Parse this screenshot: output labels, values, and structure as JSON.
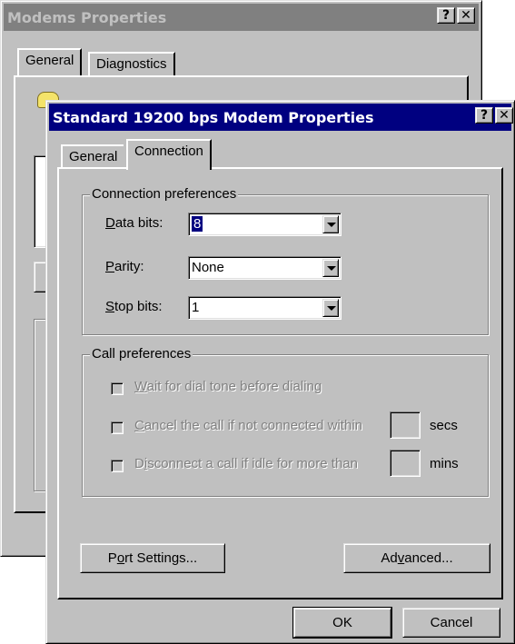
{
  "back_window": {
    "title": "Modems Properties",
    "help_button": "?",
    "close_button": "✕",
    "tabs": [
      "General",
      "Diagnostics"
    ]
  },
  "front_window": {
    "title": "Standard 19200 bps Modem Properties",
    "help_button": "?",
    "close_button": "✕",
    "tabs": [
      "General",
      "Connection"
    ],
    "active_tab": "Connection",
    "connection_preferences": {
      "legend": "Connection preferences",
      "data_bits": {
        "label_mnemonic": "D",
        "label_rest": "ata bits:",
        "value": "8"
      },
      "parity": {
        "label_mnemonic": "P",
        "label_rest": "arity:",
        "value": "None"
      },
      "stop_bits": {
        "label_mnemonic": "S",
        "label_rest": "top bits:",
        "value": "1"
      }
    },
    "call_preferences": {
      "legend": "Call preferences",
      "wait_dial_tone": {
        "mnemonic": "W",
        "rest": "ait for dial tone before dialing",
        "checked": false
      },
      "cancel_call": {
        "mnemonic": "C",
        "rest": "ancel the call if not connected within",
        "unit": "secs",
        "checked": false
      },
      "disconnect_idle": {
        "pre": "D",
        "mnemonic": "i",
        "rest": "sconnect a call if idle for more than",
        "unit": "mins",
        "checked": false
      }
    },
    "port_settings_button": {
      "pre": "P",
      "mnemonic": "o",
      "rest": "rt Settings..."
    },
    "advanced_button": {
      "pre": "Ad",
      "mnemonic": "v",
      "rest": "anced..."
    },
    "ok_button": "OK",
    "cancel_button": "Cancel"
  }
}
